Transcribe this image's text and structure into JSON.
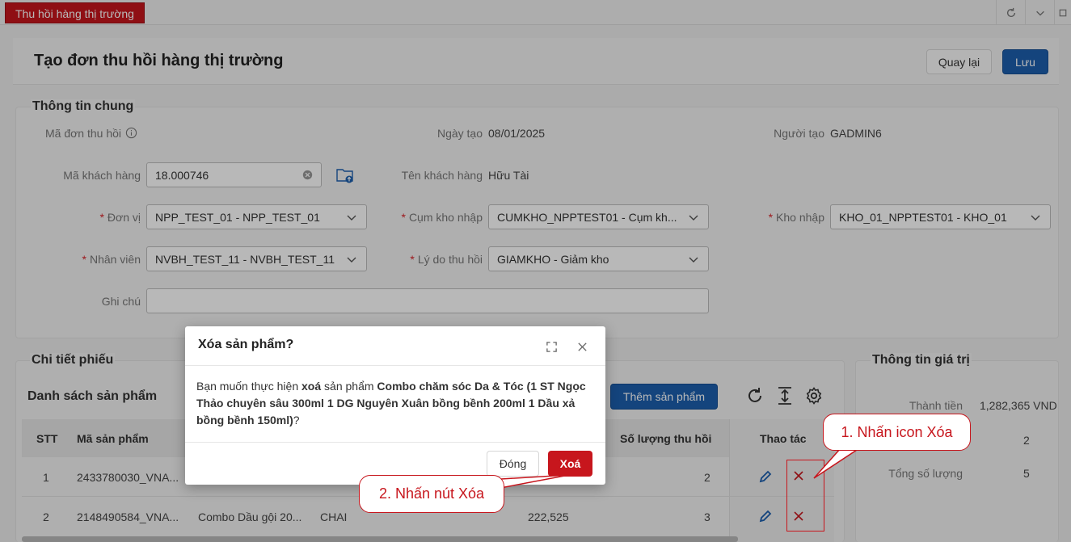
{
  "tab": {
    "label": "Thu hồi hàng thị trường"
  },
  "header": {
    "title": "Tạo đơn thu hồi hàng thị trường",
    "back_label": "Quay lại",
    "save_label": "Lưu"
  },
  "general": {
    "section_title": "Thông tin chung",
    "ma_don_label": "Mã đơn thu hồi",
    "ngay_tao_label": "Ngày tạo",
    "ngay_tao_value": "08/01/2025",
    "nguoi_tao_label": "Người tạo",
    "nguoi_tao_value": "GADMIN6",
    "ma_kh_label": "Mã khách hàng",
    "ma_kh_value": "18.000746",
    "ten_kh_label": "Tên khách hàng",
    "ten_kh_value": "Hữu Tài",
    "don_vi_label": "Đơn vị",
    "don_vi_value": "NPP_TEST_01 - NPP_TEST_01",
    "cum_kho_label": "Cụm kho nhập",
    "cum_kho_value": "CUMKHO_NPPTEST01 - Cụm kh...",
    "kho_nhap_label": "Kho nhập",
    "kho_nhap_value": "KHO_01_NPPTEST01 - KHO_01",
    "nhan_vien_label": "Nhân viên",
    "nhan_vien_value": "NVBH_TEST_11 - NVBH_TEST_11",
    "ly_do_label": "Lý do thu hồi",
    "ly_do_value": "GIAMKHO - Giảm kho",
    "ghi_chu_label": "Ghi chú",
    "ghi_chu_value": ""
  },
  "details": {
    "section_title": "Chi tiết phiếu",
    "list_title": "Danh sách sản phẩm",
    "add_button": "Thêm sản phẩm",
    "columns": {
      "stt": "STT",
      "ma_sp": "Mã sản phẩm",
      "sl_thu_hoi": "Số lượng thu hồi",
      "thao_tac": "Thao tác"
    },
    "rows": [
      {
        "stt": "1",
        "ma_sp": "2433780030_VNA...",
        "ten": "",
        "dvt": "",
        "gia": "",
        "sl": "2"
      },
      {
        "stt": "2",
        "ma_sp": "2148490584_VNA...",
        "ten": "Combo Dầu gội 20...",
        "dvt": "CHAI",
        "gia": "222,525",
        "sl": "3"
      }
    ]
  },
  "value_info": {
    "section_title": "Thông tin giá trị",
    "thanh_tien_label": "Thành tiền",
    "thanh_tien_value": "1,282,365 VND",
    "hidden_value": "2",
    "tong_sl_label": "Tổng số lượng",
    "tong_sl_value": "5"
  },
  "modal": {
    "title": "Xóa sản phẩm?",
    "msg_prefix": "Bạn muốn thực hiện ",
    "msg_action": "xoá",
    "msg_mid": " sản phẩm ",
    "msg_product": "Combo chăm sóc Da & Tóc (1 ST Ngọc Thảo chuyên sâu 300ml 1 DG Nguyên Xuân bồng bềnh 200ml 1 Dầu xả bồng bềnh 150ml)",
    "msg_suffix": "?",
    "close_label": "Đóng",
    "delete_label": "Xoá"
  },
  "annotations": {
    "step1": "1. Nhấn icon Xóa",
    "step2": "2. Nhấn nút Xóa"
  },
  "colors": {
    "brand_red": "#c7161d",
    "primary_blue": "#1c5fae"
  }
}
